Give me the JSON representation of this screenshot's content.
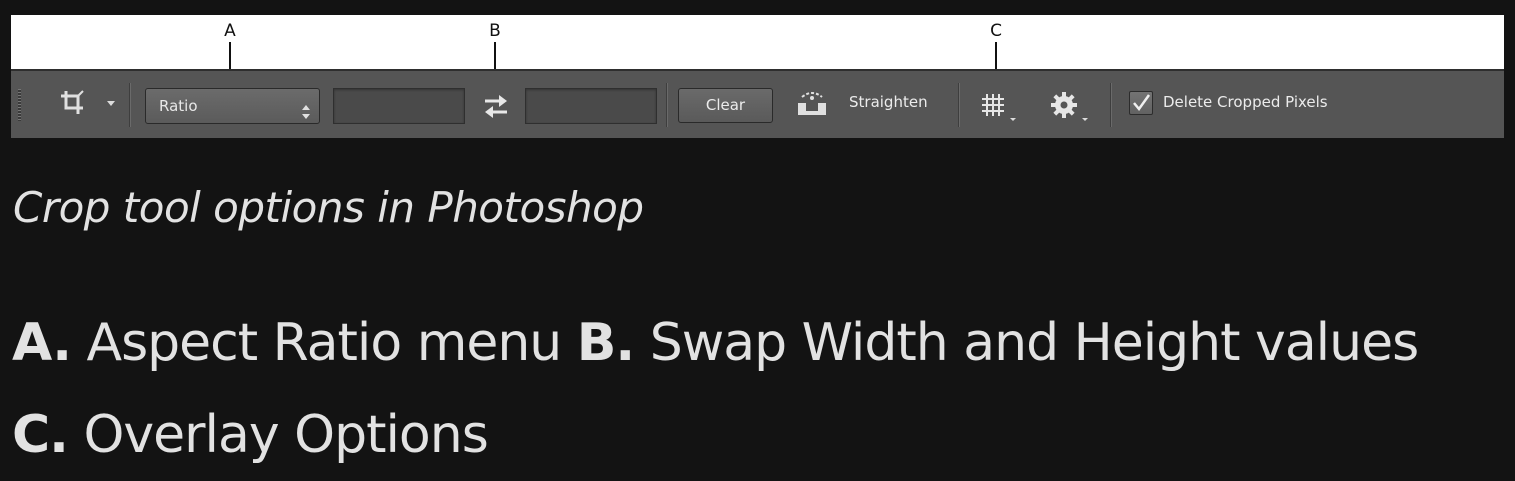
{
  "figure": {
    "callouts": {
      "a": "A",
      "b": "B",
      "c": "C"
    },
    "toolbar": {
      "tool_icon": "crop-icon",
      "aspect_ratio_select": {
        "value": "Ratio",
        "icon": "updown-arrows-icon"
      },
      "width_field": {
        "value": ""
      },
      "swap_icon": "swap-arrows-icon",
      "height_field": {
        "value": ""
      },
      "clear_label": "Clear",
      "straighten_icon": "level-icon",
      "straighten_label": "Straighten",
      "overlay_icon": "grid-icon",
      "settings_icon": "gear-icon",
      "delete_cropped": {
        "label": "Delete Cropped Pixels",
        "checked": true
      }
    }
  },
  "caption": "Crop tool options in Photoshop",
  "legend": {
    "a_key": "A.",
    "a_text": "Aspect Ratio menu",
    "b_key": "B.",
    "b_text": "Swap Width and Height values",
    "c_key": "C.",
    "c_text": "Overlay Options"
  },
  "colors": {
    "background": "#131313",
    "toolbar": "#555555",
    "text_light": "#e2e2e2"
  }
}
